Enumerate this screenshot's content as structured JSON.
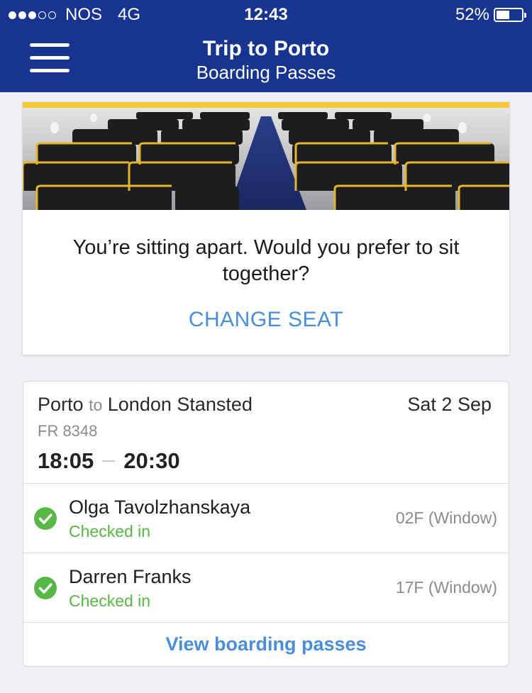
{
  "status_bar": {
    "carrier": "NOS",
    "network": "4G",
    "time": "12:43",
    "battery": "52%",
    "battery_level": 0.52,
    "signal_bars_filled": 3,
    "signal_bars_total": 5
  },
  "header": {
    "title": "Trip to Porto",
    "subtitle": "Boarding Passes",
    "menu_icon": "hamburger-menu-icon"
  },
  "seat_prompt": {
    "message": "You’re sitting apart. Would you prefer to sit together?",
    "action_label": "CHANGE SEAT"
  },
  "flight": {
    "origin": "Porto",
    "connector": "to",
    "destination": "London Stansted",
    "date": "Sat 2 Sep",
    "flight_number": "FR 8348",
    "departure_time": "18:05",
    "arrival_time": "20:30"
  },
  "passengers": [
    {
      "name": "Olga Tavolzhanskaya",
      "status": "Checked in",
      "seat": "02F (Window)"
    },
    {
      "name": "Darren Franks",
      "status": "Checked in",
      "seat": "17F (Window)"
    }
  ],
  "footer_action": {
    "label": "View boarding passes"
  },
  "colors": {
    "header_blue": "#173590",
    "link_blue": "#4a8ed8",
    "checked_green": "#58b845",
    "accent_yellow": "#f1c933"
  }
}
